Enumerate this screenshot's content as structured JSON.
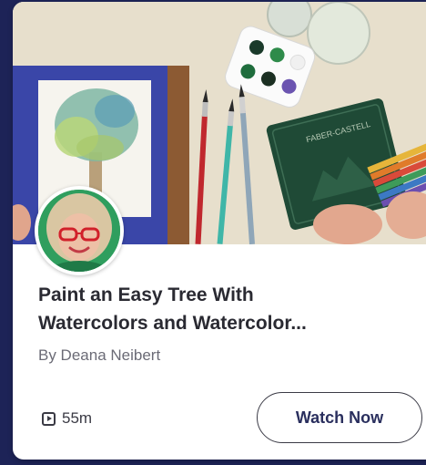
{
  "course": {
    "title_line1": "Paint an Easy Tree With",
    "title_line2": "Watercolors and Watercolor...",
    "author": "By Deana Neibert",
    "duration": "55m",
    "watch_label": "Watch Now",
    "pencil_tin_label": "FABER-CASTELL"
  },
  "colors": {
    "page_background": "#1d2357",
    "card_background": "#ffffff",
    "title_text": "#2a2a32",
    "button_text": "#2a2f5e"
  },
  "icons": {
    "duration": "play-icon"
  }
}
